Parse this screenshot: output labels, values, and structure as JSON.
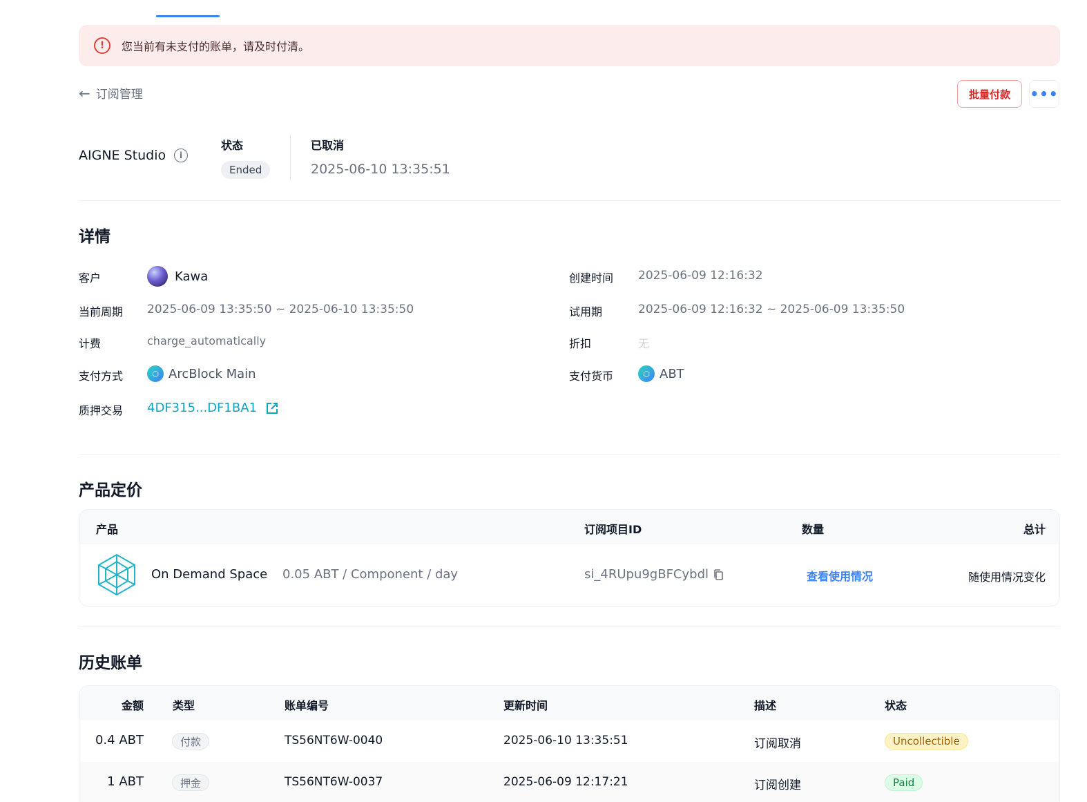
{
  "alert": {
    "icon": "alert-circle-icon",
    "text": "您当前有未支付的账单，请及时付清。"
  },
  "nav": {
    "back_label": "订阅管理",
    "back_icon": "arrow-left-icon"
  },
  "actions": {
    "batch_pay": "批量付款",
    "more": "•••"
  },
  "subscription": {
    "product": "AIGNE Studio",
    "status_label": "状态",
    "status_value": "Ended",
    "cancelled_label": "已取消",
    "cancelled_time": "2025-06-10 13:35:51"
  },
  "details": {
    "title": "详情",
    "customer_label": "客户",
    "customer_name": "Kawa",
    "created_label": "创建时间",
    "created_value": "2025-06-09 12:16:32",
    "period_label": "当前周期",
    "period_value": "2025-06-09 13:35:50 ~ 2025-06-10 13:35:50",
    "trial_label": "试用期",
    "trial_value": "2025-06-09 12:16:32 ~ 2025-06-09 13:35:50",
    "billing_label": "计费",
    "billing_value": "charge_automatically",
    "discount_label": "折扣",
    "discount_value": "无",
    "payment_method_label": "支付方式",
    "payment_method_value": "ArcBlock Main",
    "currency_label": "支付货币",
    "currency_value": "ABT",
    "stake_label": "质押交易",
    "stake_value": "4DF315...DF1BA1"
  },
  "pricing": {
    "title": "产品定价",
    "headers": {
      "product": "产品",
      "item_id": "订阅项目ID",
      "quantity": "数量",
      "total": "总计"
    },
    "row": {
      "name": "On Demand Space",
      "price": "0.05 ABT / Component / day",
      "item_id": "si_4RUpu9gBFCybdl",
      "quantity_link": "查看使用情况",
      "total": "随使用情况变化"
    }
  },
  "invoices": {
    "title": "历史账单",
    "headers": {
      "amount": "金额",
      "type": "类型",
      "number": "账单编号",
      "updated": "更新时间",
      "desc": "描述",
      "status": "状态"
    },
    "rows": [
      {
        "amount": "0.4 ABT",
        "type": "付款",
        "number": "TS56NT6W-0040",
        "updated": "2025-06-10 13:35:51",
        "desc": "订阅取消",
        "status": "Uncollectible"
      },
      {
        "amount": "1 ABT",
        "type": "押金",
        "number": "TS56NT6W-0037",
        "updated": "2025-06-09 12:17:21",
        "desc": "订阅创建",
        "status": "Paid"
      }
    ]
  },
  "colors": {
    "accent": "#3b82f6",
    "danger": "#dc2626",
    "link": "#0ea5c6",
    "alert_bg": "#fdecec"
  }
}
